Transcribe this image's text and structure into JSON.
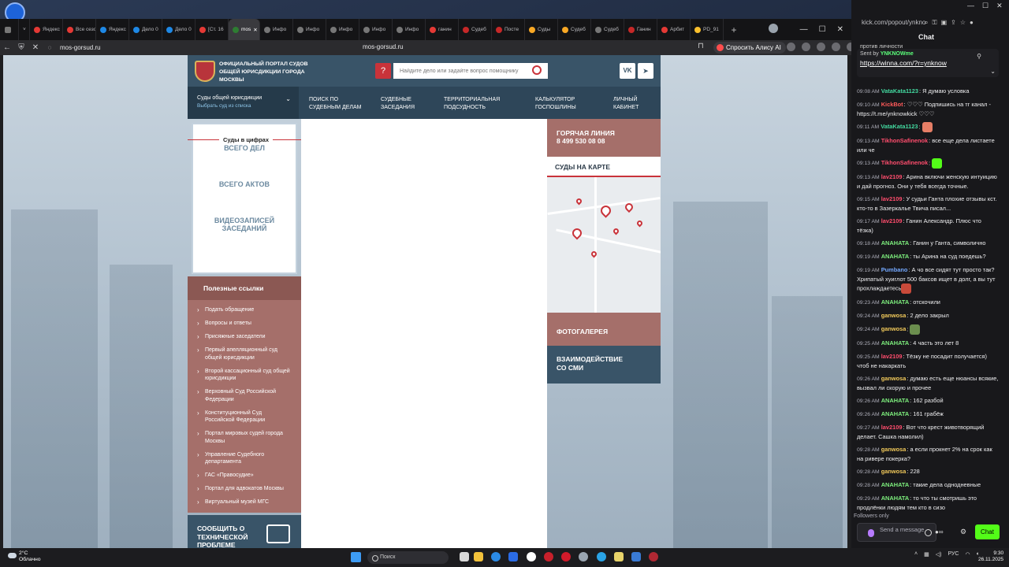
{
  "browser": {
    "tabs": [
      {
        "label": "Яндекс",
        "color": "#e53935"
      },
      {
        "label": "Все сезоны",
        "color": "#e53935"
      },
      {
        "label": "Яндекс",
        "color": "#1e88e5"
      },
      {
        "label": "Дело 0",
        "color": "#1e88e5"
      },
      {
        "label": "Дело 0",
        "color": "#1e88e5"
      },
      {
        "label": "[Ст. 16",
        "color": "#e53935"
      },
      {
        "label": "mos",
        "color": "#2e7d32",
        "active": true
      },
      {
        "label": "Инфо",
        "color": "#777"
      },
      {
        "label": "Инфо",
        "color": "#777"
      },
      {
        "label": "Инфо",
        "color": "#777"
      },
      {
        "label": "Инфо",
        "color": "#777"
      },
      {
        "label": "Инфо",
        "color": "#777"
      },
      {
        "label": "ганин",
        "color": "#e53935"
      },
      {
        "label": "Судеб",
        "color": "#c62828"
      },
      {
        "label": "Посте",
        "color": "#c62828"
      },
      {
        "label": "Суды",
        "color": "#f9a825"
      },
      {
        "label": "Судеб",
        "color": "#f9a825"
      },
      {
        "label": "Судеб",
        "color": "#777"
      },
      {
        "label": "Ганин",
        "color": "#c62828"
      },
      {
        "label": "Арбит",
        "color": "#e53935"
      },
      {
        "label": "PD_91",
        "color": "#fbc02d"
      }
    ],
    "tab_plus": "+",
    "domain": "mos-gorsud.ru",
    "url_center": "mos-gorsud.ru",
    "alice": "Спросить Алису AI"
  },
  "portal": {
    "title": "Официальный портал судов общей юрисдикции города Москвы",
    "search_placeholder": "Найдите дело или задайте вопрос помощнику",
    "vk": "VK",
    "nav": {
      "courts": "Суды общей юрисдикции",
      "courts_sub": "Выбрать суд из списка",
      "items": [
        "Поиск по судебным делам",
        "Судебные заседания",
        "Территориальная подсудность",
        "Калькулятор госпошлины",
        "Личный кабинет"
      ]
    },
    "stats": {
      "title": "Суды в цифрах",
      "items": [
        "ВСЕГО ДЕЛ",
        "ВСЕГО АКТОВ",
        "ВИДЕОЗАПИСЕЙ ЗАСЕДАНИЙ"
      ]
    },
    "links": {
      "title": "Полезные ссылки",
      "items": [
        "Подать обращение",
        "Вопросы и ответы",
        "Присяжные заседатели",
        "Первый апелляционный суд общей юрисдикции",
        "Второй кассационный суд общей юрисдикции",
        "Верховный Суд Российской Федерации",
        "Конституционный Суд Российской Федерации",
        "Портал мировых судей города Москвы",
        "Управление Судебного департамента",
        "ГАС «Правосудие»",
        "Портал для адвокатов Москвы",
        "Виртуальный музей МГС"
      ]
    },
    "report": "Сообщить о технической проблеме",
    "hotline_title": "Горячая линия",
    "hotline_phone": "8 499 530 08 08",
    "map_title": "Суды на карте",
    "gallery": "Фотогалерея",
    "media": "Взаимодействие со СМИ"
  },
  "chat": {
    "url": "kick.com/popout/ynkno",
    "title": "Chat",
    "pinned_top": "против личности",
    "pinned_sender_label": "Sent by",
    "pinned_sender": "YNKNOWme",
    "pinned_link": "https://winna.com/?r=ynknow",
    "messages": [
      {
        "time": "09:08 AM",
        "user": "VataKata1123",
        "color": "#43d9a0",
        "text": "Я думаю условка"
      },
      {
        "time": "09:10 AM",
        "user": "KickBot",
        "color": "#ff5a5a",
        "text": "♡♡♡ Подпишись на тг канал - https://t.me/ynknowkick ♡♡♡"
      },
      {
        "time": "09:11 AM",
        "user": "VataKata1123",
        "color": "#43d9a0",
        "text": "",
        "emote": "#e67e66"
      },
      {
        "time": "09:13 AM",
        "user": "TikhonSafinenok",
        "color": "#ff4d6d",
        "text": "все еще дела листаете или че"
      },
      {
        "time": "09:13 AM",
        "user": "TikhonSafinenok",
        "color": "#ff4d6d",
        "text": "",
        "emote": "#53fc18"
      },
      {
        "time": "09:13 AM",
        "user": "lav2109",
        "color": "#ff4d6d",
        "text": "Арина включи женскую интуицию и дай прогноз. Они у тебя всегда точные."
      },
      {
        "time": "09:15 AM",
        "user": "lav2109",
        "color": "#ff4d6d",
        "text": "У судьи Ганта плохие отзывы кст. кто-то в Зазеркалье Твича писал..."
      },
      {
        "time": "09:17 AM",
        "user": "lav2109",
        "color": "#ff4d6d",
        "text": "Ганин Александр. Плюс что тёзка)"
      },
      {
        "time": "09:18 AM",
        "user": "ANAHATA",
        "color": "#7ef07e",
        "text": "Ганин у Ганта, символично"
      },
      {
        "time": "09:19 AM",
        "user": "ANAHATA",
        "color": "#7ef07e",
        "text": "ты Арина на суд поедешь?"
      },
      {
        "time": "09:19 AM",
        "user": "Pumbano",
        "color": "#74a9ff",
        "text": "А чо все сидят тут просто так? Хрипатый хуиглот 500 баксов ищет в долг, а вы тут прохлаждаетесь",
        "emote": "#c94a3a"
      },
      {
        "time": "09:23 AM",
        "user": "ANAHATA",
        "color": "#7ef07e",
        "text": "отскочили"
      },
      {
        "time": "09:24 AM",
        "user": "ganwosa",
        "color": "#f0c85a",
        "text": "2 дело закрыл"
      },
      {
        "time": "09:24 AM",
        "user": "ganwosa",
        "color": "#f0c85a",
        "text": "",
        "emote": "#6b8e4e"
      },
      {
        "time": "09:25 AM",
        "user": "ANAHATA",
        "color": "#7ef07e",
        "text": "4 часть это лет 8"
      },
      {
        "time": "09:25 AM",
        "user": "lav2109",
        "color": "#ff4d6d",
        "text": "Тёзку не посадит получается) чтоб не накаркать"
      },
      {
        "time": "09:26 AM",
        "user": "ganwosa",
        "color": "#f0c85a",
        "text": "думаю есть еще нюансы всякие, вызвал ли скорую и прочее"
      },
      {
        "time": "09:26 AM",
        "user": "ANAHATA",
        "color": "#7ef07e",
        "text": "162 разбой"
      },
      {
        "time": "09:26 AM",
        "user": "ANAHATA",
        "color": "#7ef07e",
        "text": "161 грабёж"
      },
      {
        "time": "09:27 AM",
        "user": "lav2109",
        "color": "#ff4d6d",
        "text": "Вот что крест животворящий делает. Сашка намолил)"
      },
      {
        "time": "09:28 AM",
        "user": "ganwosa",
        "color": "#f0c85a",
        "text": "а если прокнет 2% на срок как на ривере покерка?"
      },
      {
        "time": "09:28 AM",
        "user": "ganwosa",
        "color": "#f0c85a",
        "text": "228"
      },
      {
        "time": "09:28 AM",
        "user": "ANAHATA",
        "color": "#7ef07e",
        "text": "такие дела однодневные"
      },
      {
        "time": "09:29 AM",
        "user": "ANAHATA",
        "color": "#7ef07e",
        "text": "то что ты смотришь это продлёнки людям тем кто в сизо"
      }
    ],
    "followers": "Followers only",
    "send_placeholder": "Send a message",
    "chat_button": "Chat"
  },
  "taskbar": {
    "weather_temp": "2°C",
    "weather_desc": "Облачно",
    "search": "Поиск",
    "lang": "РУС",
    "time": "9:30",
    "date": "26.11.2025"
  }
}
